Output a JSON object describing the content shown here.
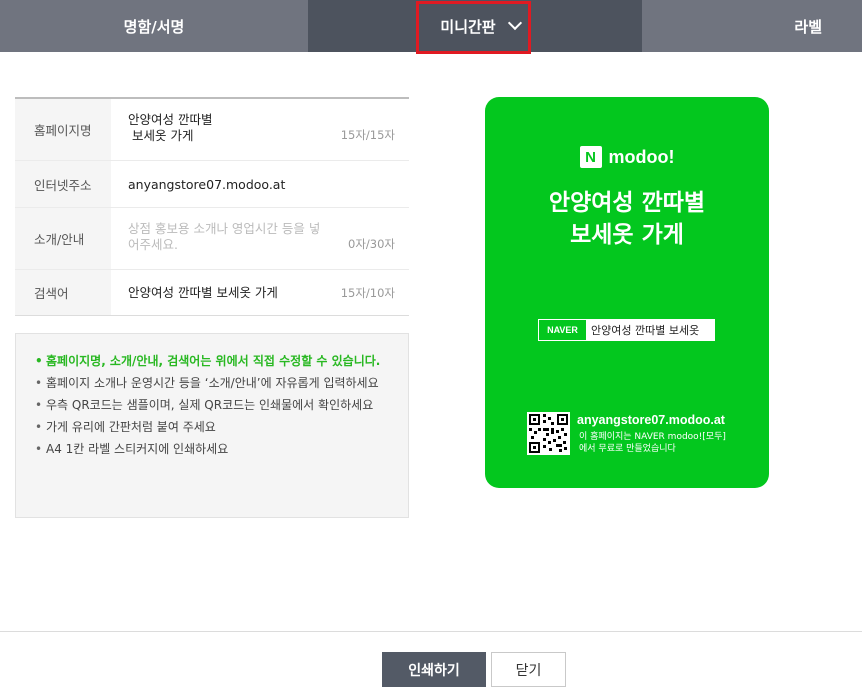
{
  "tabs": [
    {
      "label": "명함/서명"
    },
    {
      "label": "미니간판"
    },
    {
      "label": "라벨"
    }
  ],
  "form": {
    "rows": [
      {
        "label": "홈페이지명",
        "value_line1": "안양여성 깐따별",
        "value_line2": " 보세옷 가게",
        "count": "15자/15자"
      },
      {
        "label": "인터넷주소",
        "value": "anyangstore07.modoo.at"
      },
      {
        "label": "소개/안내",
        "placeholder_line1": "상점 홍보용 소개나 영업시간 등을 넣",
        "placeholder_line2": "어주세요.",
        "count": "0자/30자"
      },
      {
        "label": "검색어",
        "value": "안양여성 깐따별 보세옷 가게",
        "count": "15자/10자"
      }
    ]
  },
  "notice": {
    "items": [
      "홈페이지명, 소개/안내, 검색어는 위에서 직접 수정할 수 있습니다.",
      "홈페이지 소개나 운영시간 등을 ‘소개/안내’에 자유롭게 입력하세요",
      "우측 QR코드는 샘플이며, 실제 QR코드는 인쇄물에서 확인하세요",
      "가게 유리에 간판처럼 붙여 주세요",
      "A4 1칸 라벨 스티커지에 인쇄하세요"
    ]
  },
  "board": {
    "brand_logo": "N",
    "brand_name": "modoo!",
    "title_line1": "안양여성 깐따별",
    "title_line2": "보세옷 가게",
    "search_badge": "NAVER",
    "search_query": "안양여성 깐따별 보세옷",
    "url": "anyangstore07.modoo.at",
    "note_line1": "이 홈페이지는 NAVER modoo![모두]",
    "note_line2": "에서 무료로 만들었습니다",
    "color": "#03c71e"
  },
  "footer": {
    "print_label": "인쇄하기",
    "close_label": "닫기"
  }
}
